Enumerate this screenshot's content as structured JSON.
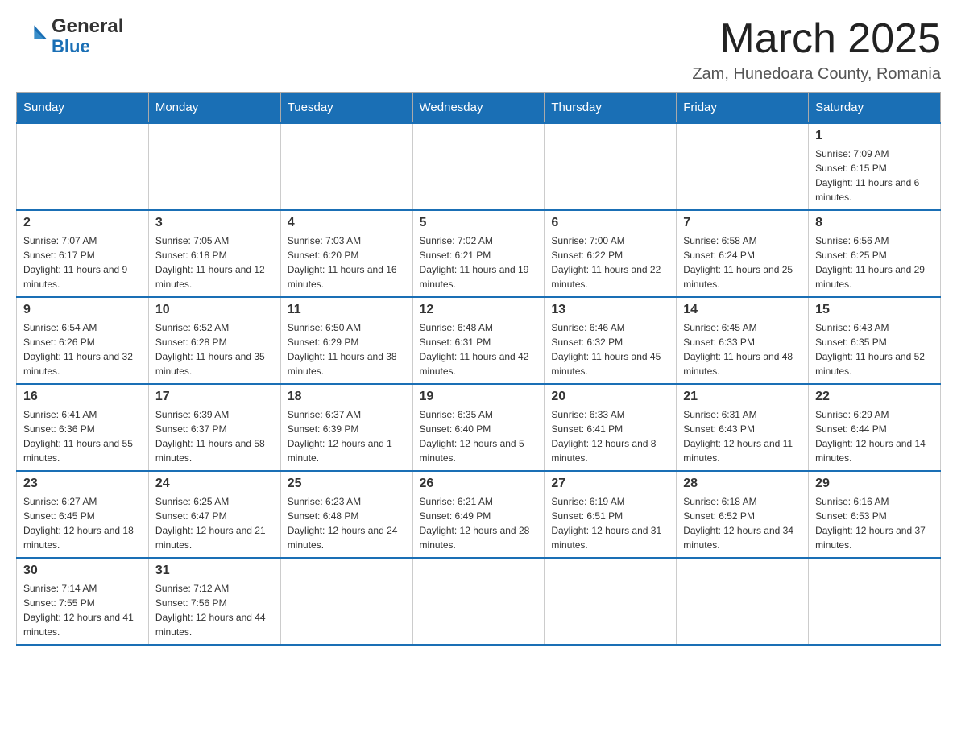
{
  "header": {
    "logo_general": "General",
    "logo_blue": "Blue",
    "month_title": "March 2025",
    "location": "Zam, Hunedoara County, Romania"
  },
  "weekdays": [
    "Sunday",
    "Monday",
    "Tuesday",
    "Wednesday",
    "Thursday",
    "Friday",
    "Saturday"
  ],
  "weeks": [
    [
      {
        "day": "",
        "info": ""
      },
      {
        "day": "",
        "info": ""
      },
      {
        "day": "",
        "info": ""
      },
      {
        "day": "",
        "info": ""
      },
      {
        "day": "",
        "info": ""
      },
      {
        "day": "",
        "info": ""
      },
      {
        "day": "1",
        "info": "Sunrise: 7:09 AM\nSunset: 6:15 PM\nDaylight: 11 hours and 6 minutes."
      }
    ],
    [
      {
        "day": "2",
        "info": "Sunrise: 7:07 AM\nSunset: 6:17 PM\nDaylight: 11 hours and 9 minutes."
      },
      {
        "day": "3",
        "info": "Sunrise: 7:05 AM\nSunset: 6:18 PM\nDaylight: 11 hours and 12 minutes."
      },
      {
        "day": "4",
        "info": "Sunrise: 7:03 AM\nSunset: 6:20 PM\nDaylight: 11 hours and 16 minutes."
      },
      {
        "day": "5",
        "info": "Sunrise: 7:02 AM\nSunset: 6:21 PM\nDaylight: 11 hours and 19 minutes."
      },
      {
        "day": "6",
        "info": "Sunrise: 7:00 AM\nSunset: 6:22 PM\nDaylight: 11 hours and 22 minutes."
      },
      {
        "day": "7",
        "info": "Sunrise: 6:58 AM\nSunset: 6:24 PM\nDaylight: 11 hours and 25 minutes."
      },
      {
        "day": "8",
        "info": "Sunrise: 6:56 AM\nSunset: 6:25 PM\nDaylight: 11 hours and 29 minutes."
      }
    ],
    [
      {
        "day": "9",
        "info": "Sunrise: 6:54 AM\nSunset: 6:26 PM\nDaylight: 11 hours and 32 minutes."
      },
      {
        "day": "10",
        "info": "Sunrise: 6:52 AM\nSunset: 6:28 PM\nDaylight: 11 hours and 35 minutes."
      },
      {
        "day": "11",
        "info": "Sunrise: 6:50 AM\nSunset: 6:29 PM\nDaylight: 11 hours and 38 minutes."
      },
      {
        "day": "12",
        "info": "Sunrise: 6:48 AM\nSunset: 6:31 PM\nDaylight: 11 hours and 42 minutes."
      },
      {
        "day": "13",
        "info": "Sunrise: 6:46 AM\nSunset: 6:32 PM\nDaylight: 11 hours and 45 minutes."
      },
      {
        "day": "14",
        "info": "Sunrise: 6:45 AM\nSunset: 6:33 PM\nDaylight: 11 hours and 48 minutes."
      },
      {
        "day": "15",
        "info": "Sunrise: 6:43 AM\nSunset: 6:35 PM\nDaylight: 11 hours and 52 minutes."
      }
    ],
    [
      {
        "day": "16",
        "info": "Sunrise: 6:41 AM\nSunset: 6:36 PM\nDaylight: 11 hours and 55 minutes."
      },
      {
        "day": "17",
        "info": "Sunrise: 6:39 AM\nSunset: 6:37 PM\nDaylight: 11 hours and 58 minutes."
      },
      {
        "day": "18",
        "info": "Sunrise: 6:37 AM\nSunset: 6:39 PM\nDaylight: 12 hours and 1 minute."
      },
      {
        "day": "19",
        "info": "Sunrise: 6:35 AM\nSunset: 6:40 PM\nDaylight: 12 hours and 5 minutes."
      },
      {
        "day": "20",
        "info": "Sunrise: 6:33 AM\nSunset: 6:41 PM\nDaylight: 12 hours and 8 minutes."
      },
      {
        "day": "21",
        "info": "Sunrise: 6:31 AM\nSunset: 6:43 PM\nDaylight: 12 hours and 11 minutes."
      },
      {
        "day": "22",
        "info": "Sunrise: 6:29 AM\nSunset: 6:44 PM\nDaylight: 12 hours and 14 minutes."
      }
    ],
    [
      {
        "day": "23",
        "info": "Sunrise: 6:27 AM\nSunset: 6:45 PM\nDaylight: 12 hours and 18 minutes."
      },
      {
        "day": "24",
        "info": "Sunrise: 6:25 AM\nSunset: 6:47 PM\nDaylight: 12 hours and 21 minutes."
      },
      {
        "day": "25",
        "info": "Sunrise: 6:23 AM\nSunset: 6:48 PM\nDaylight: 12 hours and 24 minutes."
      },
      {
        "day": "26",
        "info": "Sunrise: 6:21 AM\nSunset: 6:49 PM\nDaylight: 12 hours and 28 minutes."
      },
      {
        "day": "27",
        "info": "Sunrise: 6:19 AM\nSunset: 6:51 PM\nDaylight: 12 hours and 31 minutes."
      },
      {
        "day": "28",
        "info": "Sunrise: 6:18 AM\nSunset: 6:52 PM\nDaylight: 12 hours and 34 minutes."
      },
      {
        "day": "29",
        "info": "Sunrise: 6:16 AM\nSunset: 6:53 PM\nDaylight: 12 hours and 37 minutes."
      }
    ],
    [
      {
        "day": "30",
        "info": "Sunrise: 7:14 AM\nSunset: 7:55 PM\nDaylight: 12 hours and 41 minutes."
      },
      {
        "day": "31",
        "info": "Sunrise: 7:12 AM\nSunset: 7:56 PM\nDaylight: 12 hours and 44 minutes."
      },
      {
        "day": "",
        "info": ""
      },
      {
        "day": "",
        "info": ""
      },
      {
        "day": "",
        "info": ""
      },
      {
        "day": "",
        "info": ""
      },
      {
        "day": "",
        "info": ""
      }
    ]
  ]
}
